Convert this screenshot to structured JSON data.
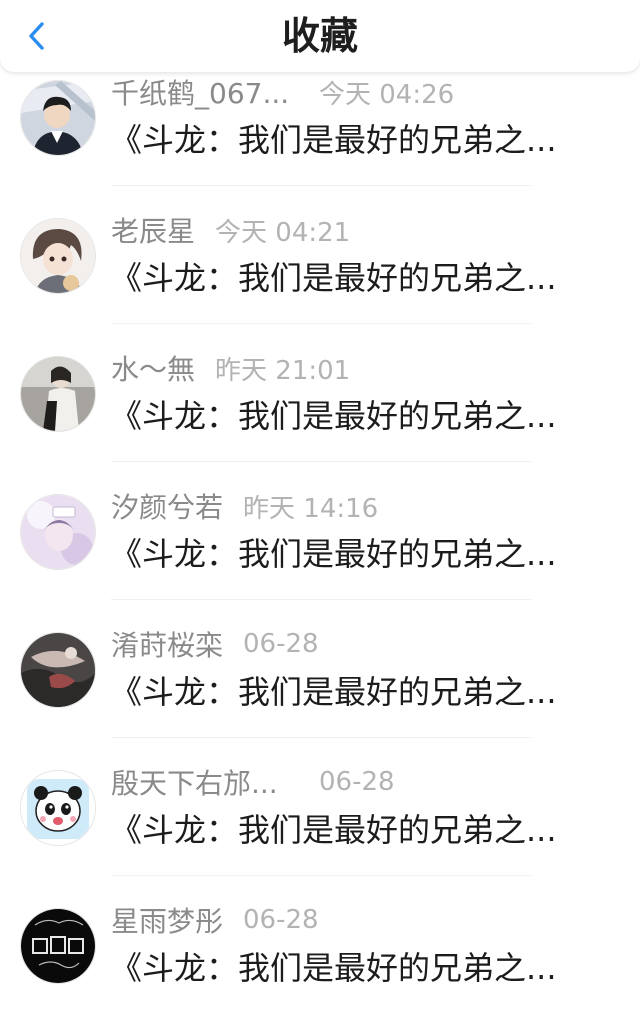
{
  "header": {
    "title": "收藏",
    "back_icon": "chevron-left-icon",
    "accent_color": "#2b8df0"
  },
  "items": [
    {
      "name": "千纸鹤_067...",
      "time": "今天 04:26",
      "content": "《斗龙：我们是最好的兄弟之...",
      "avatar": "avatar-boy-photo"
    },
    {
      "name": "老辰星",
      "time": "今天 04:21",
      "content": "《斗龙：我们是最好的兄弟之...",
      "avatar": "avatar-anime-character"
    },
    {
      "name": "水～無",
      "time": "昨天 21:01",
      "content": "《斗龙：我们是最好的兄弟之...",
      "avatar": "avatar-girl-photo"
    },
    {
      "name": "汐颜兮若",
      "time": "昨天 14:16",
      "content": "《斗龙：我们是最好的兄弟之...",
      "avatar": "avatar-pastel-photo"
    },
    {
      "name": "淆莳桜栾",
      "time": "06-28",
      "content": "《斗龙：我们是最好的兄弟之...",
      "avatar": "avatar-dark-art"
    },
    {
      "name": "殷天下右邡...",
      "time": "06-28",
      "content": "《斗龙：我们是最好的兄弟之...",
      "avatar": "avatar-panda-cartoon"
    },
    {
      "name": "星雨梦彤",
      "time": "06-28",
      "content": "《斗龙：我们是最好的兄弟之...",
      "avatar": "avatar-black-logo"
    }
  ]
}
